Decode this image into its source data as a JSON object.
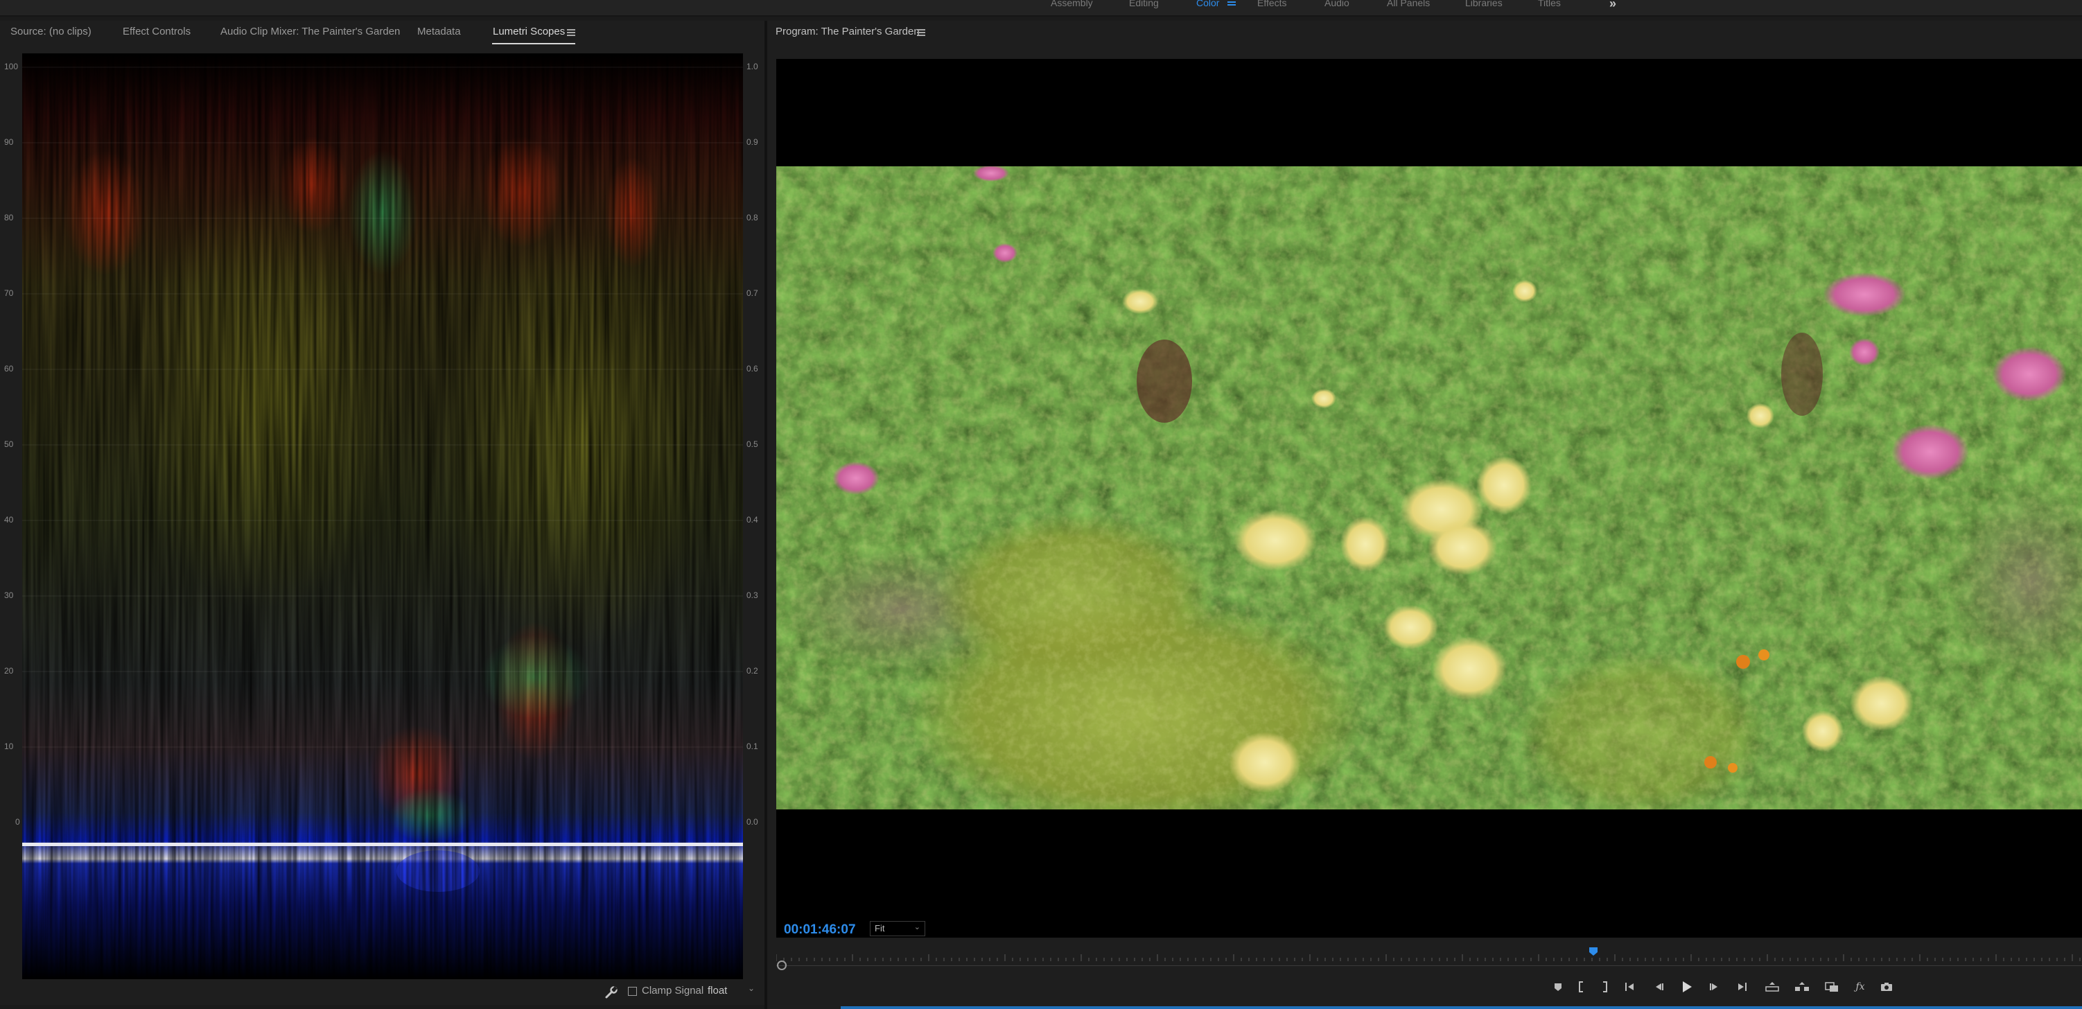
{
  "workspaces": {
    "tabs": [
      "Assembly",
      "Editing",
      "Color",
      "Effects",
      "Audio",
      "All Panels",
      "Libraries",
      "Titles"
    ],
    "active": "Color",
    "more_icon": "double-chevron-right-icon"
  },
  "left_panel": {
    "tabs": [
      {
        "label": "Source: (no clips)"
      },
      {
        "label": "Effect Controls"
      },
      {
        "label": "Audio Clip Mixer: The Painter's Garden"
      },
      {
        "label": "Metadata"
      },
      {
        "label": "Lumetri Scopes"
      }
    ],
    "active_tab": "Lumetri Scopes",
    "scope": {
      "left_axis": [
        "100",
        "90",
        "80",
        "70",
        "60",
        "50",
        "40",
        "30",
        "20",
        "10",
        "0"
      ],
      "right_axis": [
        "1.0",
        "0.9",
        "0.8",
        "0.7",
        "0.6",
        "0.5",
        "0.4",
        "0.3",
        "0.2",
        "0.1",
        "0.0"
      ]
    },
    "footer": {
      "settings_icon": "wrench-icon",
      "clamp_label": "Clamp Signal",
      "clamp_checked": false,
      "bit_depth": "float"
    }
  },
  "program_monitor": {
    "title": "Program: The Painter's Garden",
    "timecode": "00:01:46:07",
    "zoom": "Fit",
    "accent_color": "#2d8ceb",
    "transport_icons": [
      "add-marker-icon",
      "mark-in-icon",
      "mark-out-icon",
      "go-to-in-icon",
      "step-back-icon",
      "play-icon",
      "step-forward-icon",
      "go-to-out-icon",
      "lift-icon",
      "extract-icon",
      "comparison-view-icon",
      "fx-icon",
      "camera-icon"
    ]
  }
}
